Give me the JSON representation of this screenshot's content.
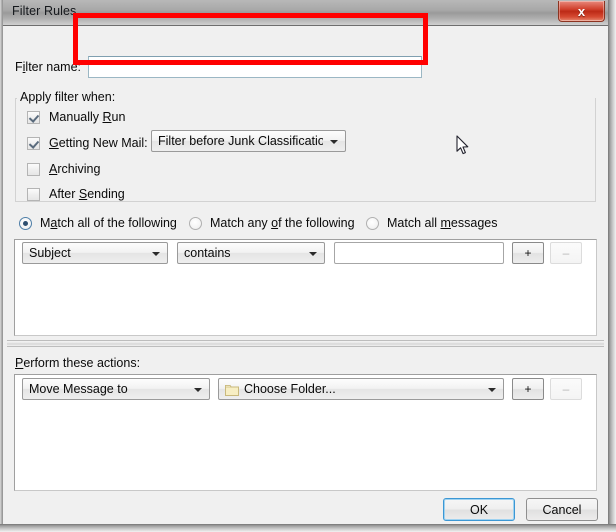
{
  "window": {
    "title": "Filter Rules",
    "close_label": "x"
  },
  "filter_name": {
    "label_pre": "F",
    "label_mn": "i",
    "label_post": "lter name:",
    "value": "",
    "placeholder": ""
  },
  "apply_when": {
    "legend": "Apply filter when:",
    "options": [
      {
        "pre": "Manually ",
        "mn": "R",
        "post": "un",
        "checked": true
      },
      {
        "pre": "",
        "mn": "G",
        "post": "etting New Mail:",
        "checked": true
      },
      {
        "pre": "",
        "mn": "A",
        "post": "rchiving",
        "checked": false
      },
      {
        "pre": "After ",
        "mn": "S",
        "post": "ending",
        "checked": false
      }
    ],
    "mail_timing_select": "Filter before Junk Classification"
  },
  "match_mode": {
    "options": [
      {
        "pre": "M",
        "mn": "a",
        "post": "tch all of the following",
        "selected": true
      },
      {
        "pre": "Match any ",
        "mn": "o",
        "post": "f the following",
        "selected": false
      },
      {
        "pre": "Match all ",
        "mn": "m",
        "post": "essages",
        "selected": false
      }
    ]
  },
  "conditions": {
    "rows": [
      {
        "field": "Subject",
        "operator": "contains",
        "value": "",
        "add_label": "+",
        "remove_label": "–",
        "remove_disabled": true
      }
    ]
  },
  "actions": {
    "legend_pre": "",
    "legend_mn": "P",
    "legend_post": "erform these actions:",
    "rows": [
      {
        "action": "Move Message to",
        "target": "Choose Folder...",
        "target_icon": "folder-icon",
        "add_label": "+",
        "remove_label": "–",
        "remove_disabled": true
      }
    ]
  },
  "footer": {
    "ok_label": "OK",
    "cancel_label": "Cancel"
  },
  "annotation": {
    "color": "#ff0000",
    "shape": "rectangle",
    "target": "filter-name-field"
  }
}
